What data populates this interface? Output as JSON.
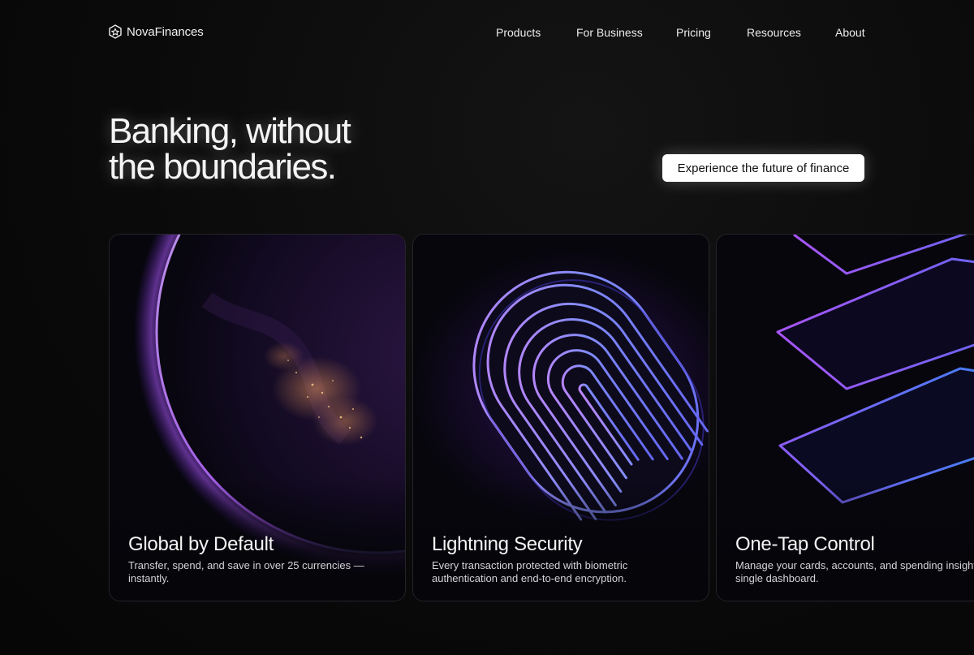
{
  "brand": {
    "name": "NovaFinances",
    "icon": "hexagon-logo-icon"
  },
  "nav": {
    "items": [
      "Products",
      "For Business",
      "Pricing",
      "Resources",
      "About"
    ]
  },
  "hero": {
    "title_line1": "Banking, without",
    "title_line2": "the boundaries.",
    "cta_label": "Experience the future of finance"
  },
  "cards": [
    {
      "title": "Global by Default",
      "description": "Transfer, spend, and save in over 25 currencies — instantly.",
      "icon": "globe-earth-image"
    },
    {
      "title": "Lightning Security",
      "description": "Every transaction protected with biometric authentication and end-to-end encryption.",
      "icon": "fingerprint-image"
    },
    {
      "title": "One-Tap Control",
      "description": "Manage your cards, accounts, and spending insights in a single dashboard.",
      "icon": "stacked-cards-image"
    }
  ],
  "colors": {
    "background": "#0a0a0a",
    "accent": "#8b5cf6",
    "accent_blue": "#4f46e5",
    "cta_bg": "#ffffff"
  }
}
